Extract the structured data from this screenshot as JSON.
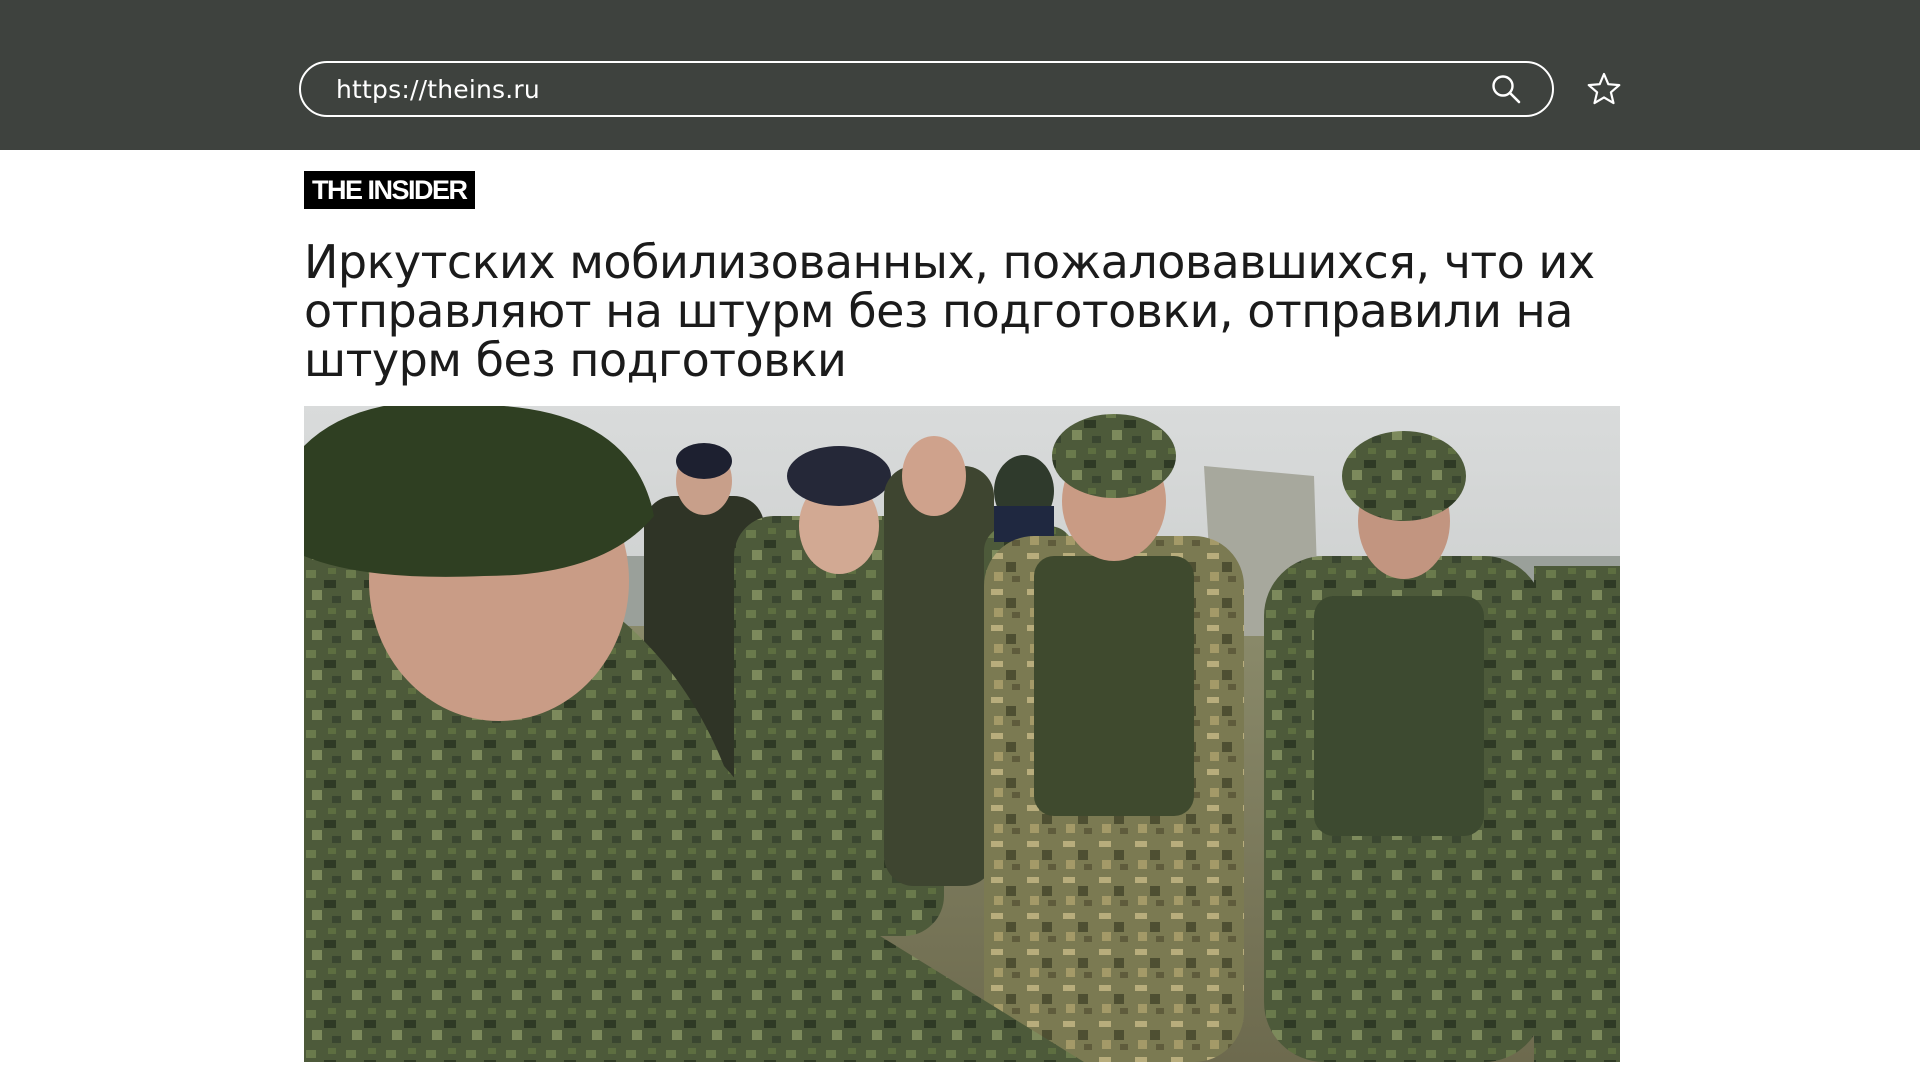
{
  "browser": {
    "url": "https://theins.ru",
    "search_icon": "search-icon",
    "bookmark_icon": "star-icon"
  },
  "site": {
    "logo_text": "THE INSIDER"
  },
  "article": {
    "headline": "Иркутских мобилизованных, пожаловавшихся, что их отправляют на штурм без подготовки, отправили на штурм без подготовки",
    "photo_alt": ""
  },
  "colors": {
    "topbar": "#3e423e",
    "logo_bg": "#000000",
    "text": "#1b1b1b"
  }
}
